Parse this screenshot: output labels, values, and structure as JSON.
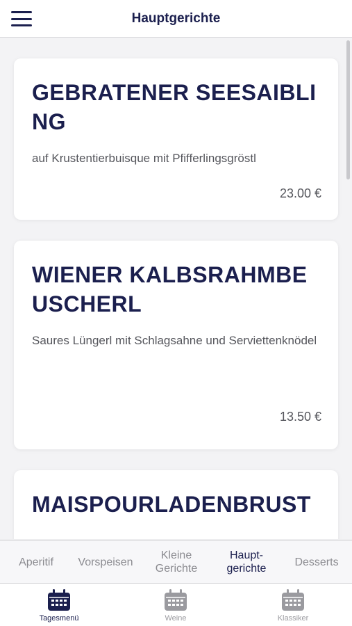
{
  "header": {
    "title": "Hauptgerichte",
    "menu_icon": "hamburger-menu-icon"
  },
  "dishes": [
    {
      "name": "GEBRATENER SEESAIBLING",
      "description": "auf Krustentierbuisque mit Pfifferlingsgröstl",
      "price": "23.00 €"
    },
    {
      "name": "WIENER KALBSRAHMBEUSCHERL",
      "description": "Saures Lüngerl mit Schlagsahne und Serviettenknödel",
      "price": "13.50 €"
    },
    {
      "name": "MAISPOURLADENBRUST",
      "description": "",
      "price": ""
    }
  ],
  "category_tabs": [
    {
      "label": "Aperitif",
      "active": false
    },
    {
      "label": "Vorspeisen",
      "active": false
    },
    {
      "label": "Kleine Gerichte",
      "active": false
    },
    {
      "label": "Haupt- gerichte",
      "active": true
    },
    {
      "label": "Desserts",
      "active": false
    }
  ],
  "bottom_nav": [
    {
      "label": "Tagesmenü",
      "icon": "calendar-icon",
      "active": true
    },
    {
      "label": "Weine",
      "icon": "calendar-icon",
      "active": false
    },
    {
      "label": "Klassiker",
      "icon": "calendar-icon",
      "active": false
    }
  ],
  "colors": {
    "accent": "#1b1f4e",
    "inactive": "#8b8b90",
    "background": "#f3f3f5"
  }
}
